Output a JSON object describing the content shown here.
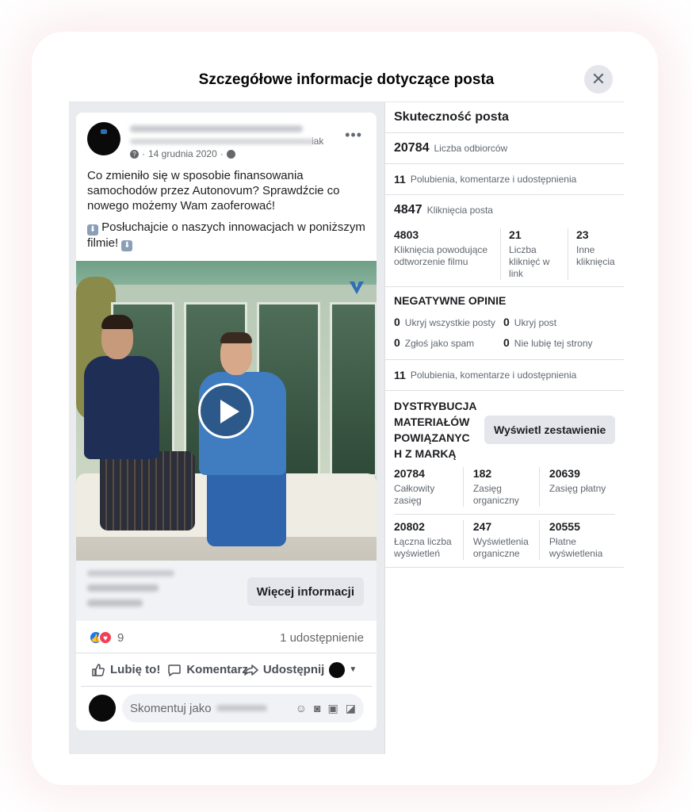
{
  "modal": {
    "title": "Szczegółowe informacje dotyczące posta",
    "close": "✕"
  },
  "post": {
    "date": "14 grudnia 2020",
    "author_suffix": "iak",
    "text_p1": "Co zmieniło się w sposobie finansowania samochodów przez Autonovum? Sprawdźcie co nowego możemy Wam zaoferować!",
    "text_p2_a": "Posłuchajcie o naszych innowacjach w poniższym filmie!",
    "more_info_label": "Więcej informacji",
    "reactions_count": "9",
    "shares_text": "1 udostępnienie",
    "actions": {
      "like": "Lubię to!",
      "comment": "Komentarz",
      "share": "Udostępnij"
    },
    "comment_placeholder": "Skomentuj jako"
  },
  "panel": {
    "title": "Skuteczność posta",
    "reach": {
      "value": "20784",
      "label": "Liczba odbiorców"
    },
    "engagement": {
      "value": "11",
      "label": "Polubienia, komentarze i udostępnienia"
    },
    "clicks": {
      "value": "4847",
      "label": "Kliknięcia posta"
    },
    "click_breakdown": [
      {
        "value": "4803",
        "label": "Kliknięcia powodujące odtworzenie filmu"
      },
      {
        "value": "21",
        "label": "Liczba kliknięć w link"
      },
      {
        "value": "23",
        "label": "Inne kliknięcia"
      }
    ],
    "negative": {
      "title": "NEGATYWNE OPINIE",
      "items": [
        {
          "value": "0",
          "label": "Ukryj wszystkie posty"
        },
        {
          "value": "0",
          "label": "Ukryj post"
        },
        {
          "value": "0",
          "label": "Zgłoś jako spam"
        },
        {
          "value": "0",
          "label": "Nie lubię tej strony"
        }
      ]
    },
    "engagement2": {
      "value": "11",
      "label": "Polubienia, komentarze i udostępnienia"
    },
    "distribution": {
      "title": "DYSTRYBUCJA MATERIAŁÓW POWIĄZANYC H Z MARKĄ",
      "button": "Wyświetl zestawienie",
      "reach": [
        {
          "value": "20784",
          "label": "Całkowity zasięg"
        },
        {
          "value": "182",
          "label": "Zasięg organiczny"
        },
        {
          "value": "20639",
          "label": "Zasięg płatny"
        }
      ],
      "views": [
        {
          "value": "20802",
          "label": "Łączna liczba wyświetleń"
        },
        {
          "value": "247",
          "label": "Wyświetlenia organiczne"
        },
        {
          "value": "20555",
          "label": "Płatne wyświetlenia"
        }
      ]
    }
  }
}
